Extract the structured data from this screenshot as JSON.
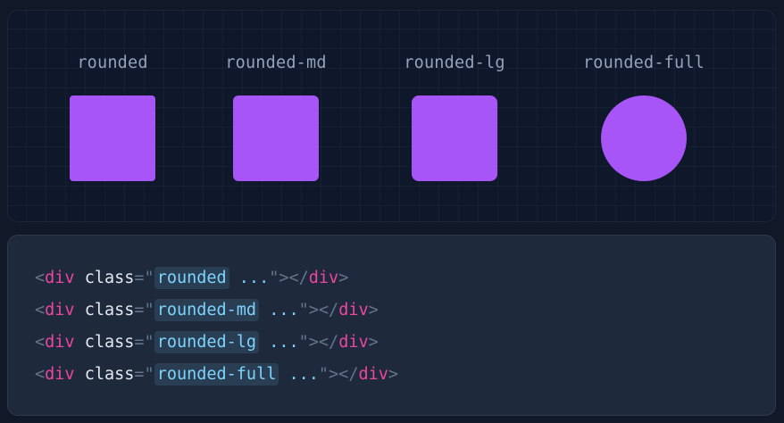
{
  "preview": {
    "items": [
      {
        "label": "rounded"
      },
      {
        "label": "rounded-md"
      },
      {
        "label": "rounded-lg"
      },
      {
        "label": "rounded-full"
      }
    ],
    "swatch_color": "#a855f7"
  },
  "code": {
    "lt": "<",
    "gt": ">",
    "close_open": "></",
    "tag": "div",
    "attr": "class",
    "eq": "=",
    "quote": "\"",
    "ellipsis": " ...",
    "lines": [
      {
        "cls": "rounded"
      },
      {
        "cls": "rounded-md"
      },
      {
        "cls": "rounded-lg"
      },
      {
        "cls": "rounded-full"
      }
    ]
  }
}
